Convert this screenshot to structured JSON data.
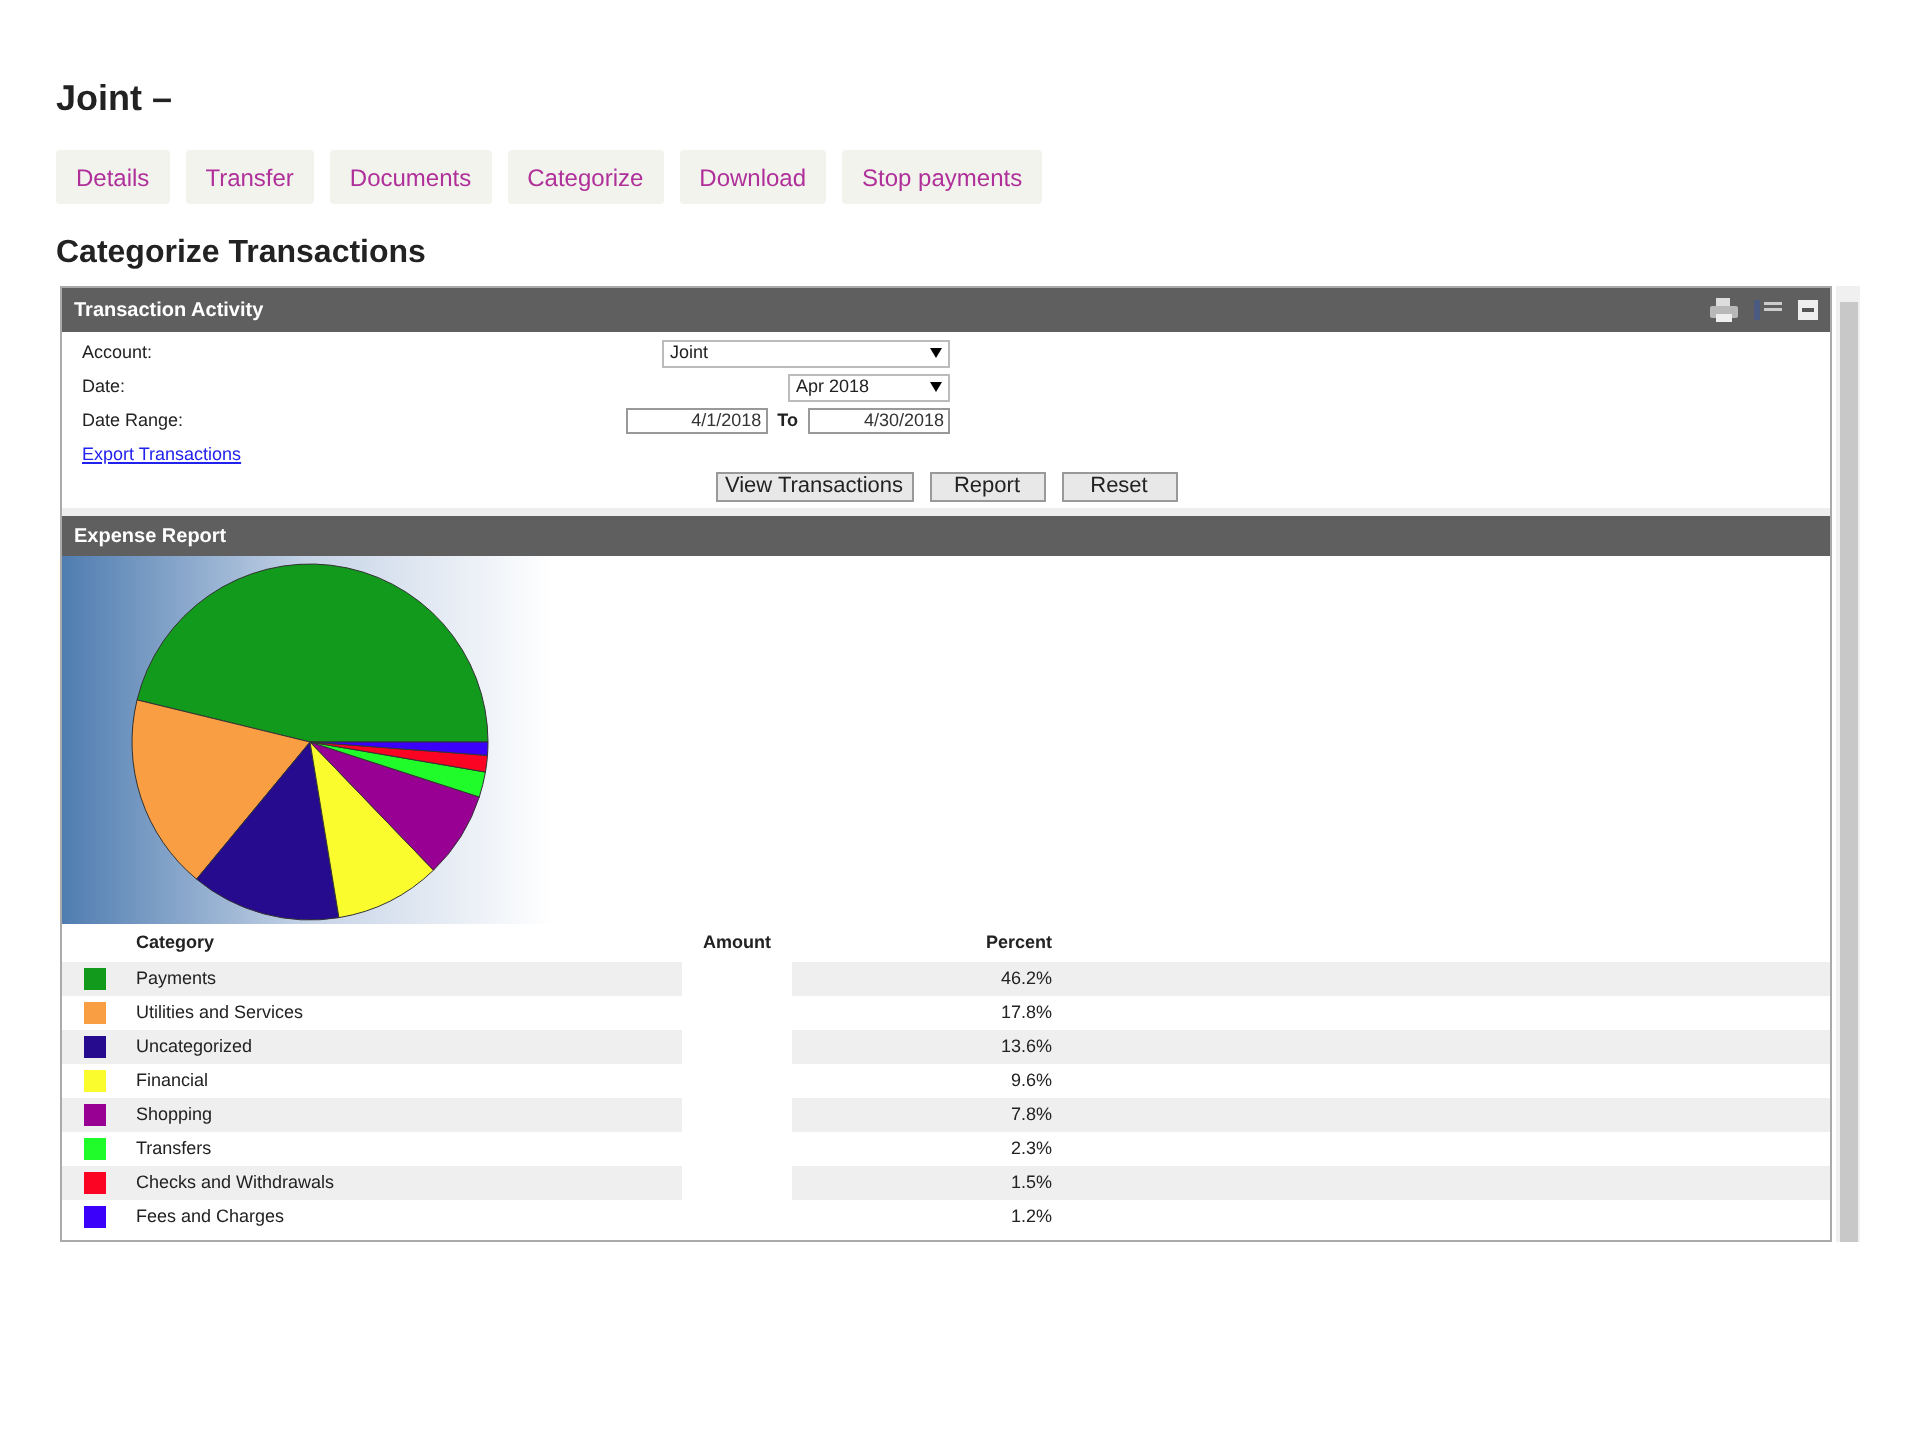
{
  "page_title": "Joint –",
  "nav_buttons": [
    "Details",
    "Transfer",
    "Documents",
    "Categorize",
    "Download",
    "Stop payments"
  ],
  "section_title": "Categorize Transactions",
  "activity_panel": {
    "title": "Transaction Activity",
    "account": {
      "label": "Account:",
      "value": "Joint"
    },
    "date": {
      "label": "Date:",
      "value": "Apr 2018"
    },
    "date_range": {
      "label": "Date Range:",
      "from": "4/1/2018",
      "to_label": "To",
      "to": "4/30/2018"
    },
    "export_link": "Export Transactions",
    "buttons": [
      "View Transactions",
      "Report",
      "Reset"
    ]
  },
  "expense_report": {
    "title": "Expense Report",
    "columns": [
      "Category",
      "Amount",
      "Percent"
    ],
    "rows": [
      {
        "category": "Payments",
        "percent": "46.2%",
        "color": "#119a1c"
      },
      {
        "category": "Utilities and Services",
        "percent": "17.8%",
        "color": "#f99e42"
      },
      {
        "category": "Uncategorized",
        "percent": "13.6%",
        "color": "#260b8f"
      },
      {
        "category": "Financial",
        "percent": "9.6%",
        "color": "#fbfc2e"
      },
      {
        "category": "Shopping",
        "percent": "7.8%",
        "color": "#970093"
      },
      {
        "category": "Transfers",
        "percent": "2.3%",
        "color": "#20fb2a"
      },
      {
        "category": "Checks and Withdrawals",
        "percent": "1.5%",
        "color": "#fb0323"
      },
      {
        "category": "Fees and Charges",
        "percent": "1.2%",
        "color": "#3b00fa"
      }
    ]
  }
}
